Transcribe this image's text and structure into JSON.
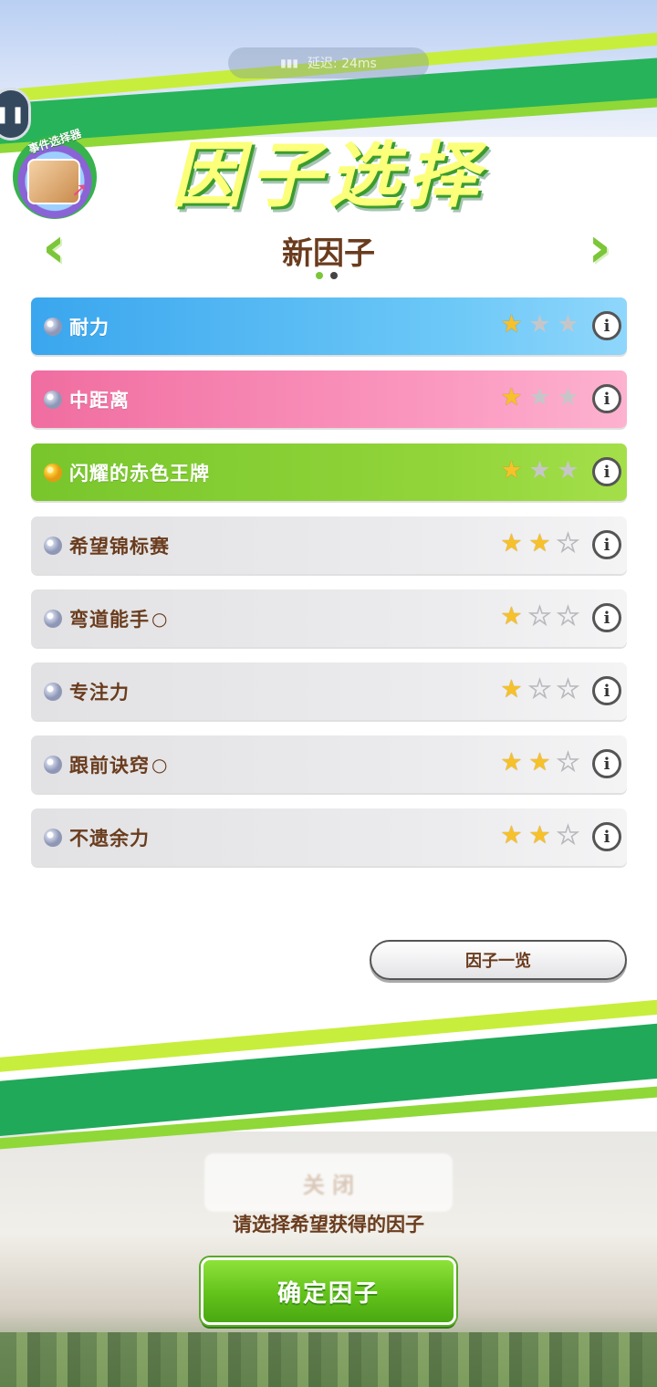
{
  "status_pill": {
    "signal_icon": "signal-icon",
    "latency": "延迟: 24ms",
    "extra": "·"
  },
  "float_button": {
    "label": "··"
  },
  "event_badge": {
    "text": "事件选择器"
  },
  "title": "因子选择",
  "header": {
    "subtitle": "新因子",
    "pages": 2,
    "current_page": 1,
    "prev_icon": "chevron-left-icon",
    "next_icon": "chevron-right-icon"
  },
  "factors": [
    {
      "name": "耐力",
      "variant": "blue",
      "gem": "silver",
      "stars": 1,
      "max_stars": 3,
      "hollow": ""
    },
    {
      "name": "中距离",
      "variant": "pink",
      "gem": "silver",
      "stars": 1,
      "max_stars": 3,
      "hollow": ""
    },
    {
      "name": "闪耀的赤色王牌",
      "variant": "green",
      "gem": "gold",
      "stars": 1,
      "max_stars": 3,
      "hollow": ""
    },
    {
      "name": "希望锦标赛",
      "variant": "grey",
      "gem": "silver",
      "stars": 2,
      "max_stars": 3,
      "hollow": ""
    },
    {
      "name": "弯道能手",
      "variant": "grey",
      "gem": "silver",
      "stars": 1,
      "max_stars": 3,
      "hollow": "○"
    },
    {
      "name": "专注力",
      "variant": "grey",
      "gem": "silver",
      "stars": 1,
      "max_stars": 3,
      "hollow": ""
    },
    {
      "name": "跟前诀窍",
      "variant": "grey",
      "gem": "silver",
      "stars": 2,
      "max_stars": 3,
      "hollow": "○"
    },
    {
      "name": "不遗余力",
      "variant": "grey",
      "gem": "silver",
      "stars": 2,
      "max_stars": 3,
      "hollow": ""
    }
  ],
  "factor_list_button": "因子一览",
  "ghost_button": "关 闭",
  "hint": "请选择希望获得的因子",
  "confirm_button": "确定因子",
  "colors": {
    "brown_text": "#6a3c1e",
    "accent_green": "#7cc63a",
    "star_gold": "#f6c12a"
  }
}
